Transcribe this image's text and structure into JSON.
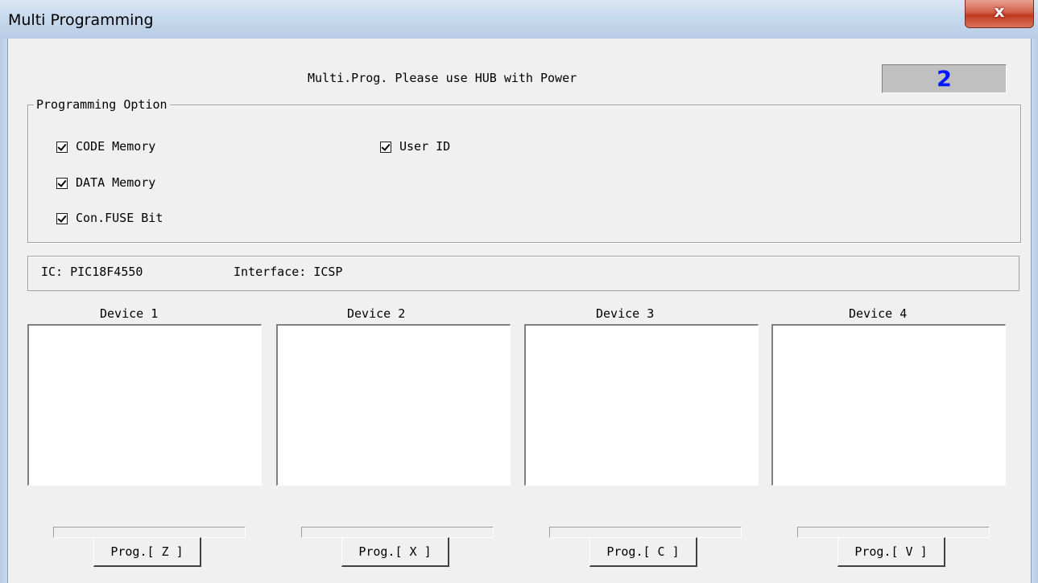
{
  "window": {
    "title": "Multi Programming",
    "close_label": "x"
  },
  "header": {
    "message": "Multi.Prog. Please use HUB with Power",
    "counter": "2"
  },
  "options": {
    "legend": "Programming Option",
    "items": [
      {
        "label": "CODE Memory",
        "checked": true
      },
      {
        "label": "DATA Memory",
        "checked": true
      },
      {
        "label": "Con.FUSE Bit",
        "checked": true
      },
      {
        "label": "User ID",
        "checked": true
      }
    ]
  },
  "info": {
    "ic": "IC: PIC18F4550",
    "interface": "Interface: ICSP"
  },
  "devices": [
    {
      "label": "Device 1",
      "button": "Prog.[ Z ]",
      "progress": 0
    },
    {
      "label": "Device 2",
      "button": "Prog.[ X ]",
      "progress": 0
    },
    {
      "label": "Device 3",
      "button": "Prog.[ C ]",
      "progress": 0
    },
    {
      "label": "Device 4",
      "button": "Prog.[ V ]",
      "progress": 0
    }
  ],
  "colors": {
    "counter_text": "#0018ff",
    "close_button": "#c0391f"
  }
}
